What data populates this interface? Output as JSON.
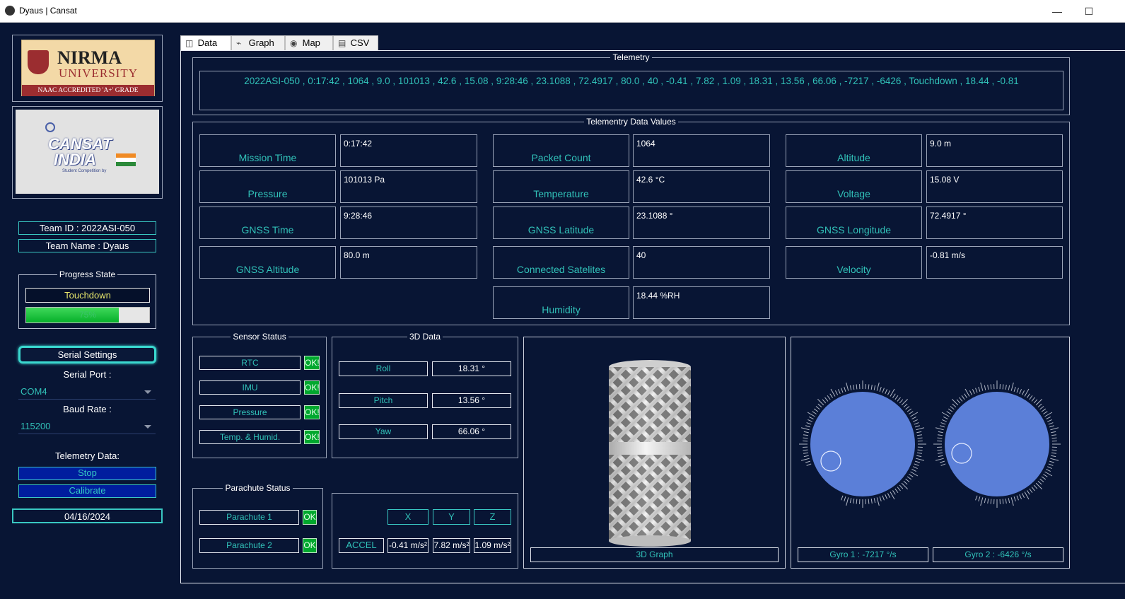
{
  "window": {
    "title": "Dyaus | Cansat",
    "minimize": "—",
    "maximize": "☐"
  },
  "sidebar": {
    "nirma_logo": {
      "line1": "NIRMA",
      "line2": "UNIVERSITY",
      "line3": "NAAC ACCREDITED 'A+' GRADE"
    },
    "cansat_logo": {
      "line1": "CANSAT",
      "line2": "INDIA",
      "line3": "Student Competition by"
    },
    "team_id": "Team ID : 2022ASI-050",
    "team_name": "Team Name : Dyaus",
    "progress": {
      "title": "Progress State",
      "state": "Touchdown",
      "percent_label": "75%",
      "percent": 75
    },
    "serial_settings": "Serial Settings",
    "serial_port_label": "Serial Port :",
    "serial_port": "COM4",
    "baud_rate_label": "Baud Rate :",
    "baud_rate": "115200",
    "telemetry_label": "Telemetry Data:",
    "stop": "Stop",
    "calibrate": "Calibrate",
    "date": "04/16/2024"
  },
  "tabs": [
    "Data",
    "Graph",
    "Map",
    "CSV"
  ],
  "telemetry": {
    "title": "Telemetry",
    "line": "2022ASI-050 , 0:17:42 , 1064 , 9.0 , 101013 , 42.6 , 15.08 , 9:28:46 , 23.1088 , 72.4917 , 80.0 , 40 , -0.41 , 7.82 , 1.09 , 18.31 , 13.56 , 66.06 , -7217 , -6426 , Touchdown , 18.44 , -0.81"
  },
  "values": {
    "title": "Telementry Data Values",
    "mission_time": {
      "label": "Mission Time",
      "value": "0:17:42"
    },
    "packet_count": {
      "label": "Packet Count",
      "value": "1064"
    },
    "altitude": {
      "label": "Altitude",
      "value": "9.0 m"
    },
    "pressure": {
      "label": "Pressure",
      "value": "101013 Pa"
    },
    "temperature": {
      "label": "Temperature",
      "value": "42.6 °C"
    },
    "voltage": {
      "label": "Voltage",
      "value": "15.08 V"
    },
    "gnss_time": {
      "label": "GNSS Time",
      "value": "9:28:46"
    },
    "gnss_latitude": {
      "label": "GNSS Latitude",
      "value": "23.1088 °"
    },
    "gnss_longitude": {
      "label": "GNSS Longitude",
      "value": "72.4917 °"
    },
    "gnss_altitude": {
      "label": "GNSS Altitude",
      "value": "80.0 m"
    },
    "connected_satellites": {
      "label": "Connected Satelites",
      "value": "40"
    },
    "velocity": {
      "label": "Velocity",
      "value": "-0.81 m/s"
    },
    "humidity": {
      "label": "Humidity",
      "value": "18.44 %RH"
    }
  },
  "sensor_status": {
    "title": "Sensor Status",
    "rtc": "RTC",
    "imu": "IMU",
    "pressure": "Pressure",
    "temp_humid": "Temp. & Humid.",
    "ok": "OK!"
  },
  "data3d": {
    "title": "3D Data",
    "roll_label": "Roll",
    "roll": "18.31 °",
    "pitch_label": "Pitch",
    "pitch": "13.56 °",
    "yaw_label": "Yaw",
    "yaw": "66.06 °"
  },
  "parachute": {
    "title": "Parachute Status",
    "p1": "Parachute 1",
    "p2": "Parachute 2",
    "ok": "OK"
  },
  "accel": {
    "x": "X",
    "y": "Y",
    "z": "Z",
    "label": "ACCEL",
    "x_val": "-0.41 m/s²",
    "y_val": "7.82 m/s²",
    "z_val": "1.09 m/s²"
  },
  "graph3d_label": "3D Graph",
  "gyro": {
    "g1": "Gyro 1 : -7217 °/s",
    "g2": "Gyro 2 : -6426 °/s"
  },
  "colors": {
    "background": "#081534",
    "accent": "#31c1b8",
    "ok": "#00a82e",
    "button_blue": "#001d9e"
  }
}
